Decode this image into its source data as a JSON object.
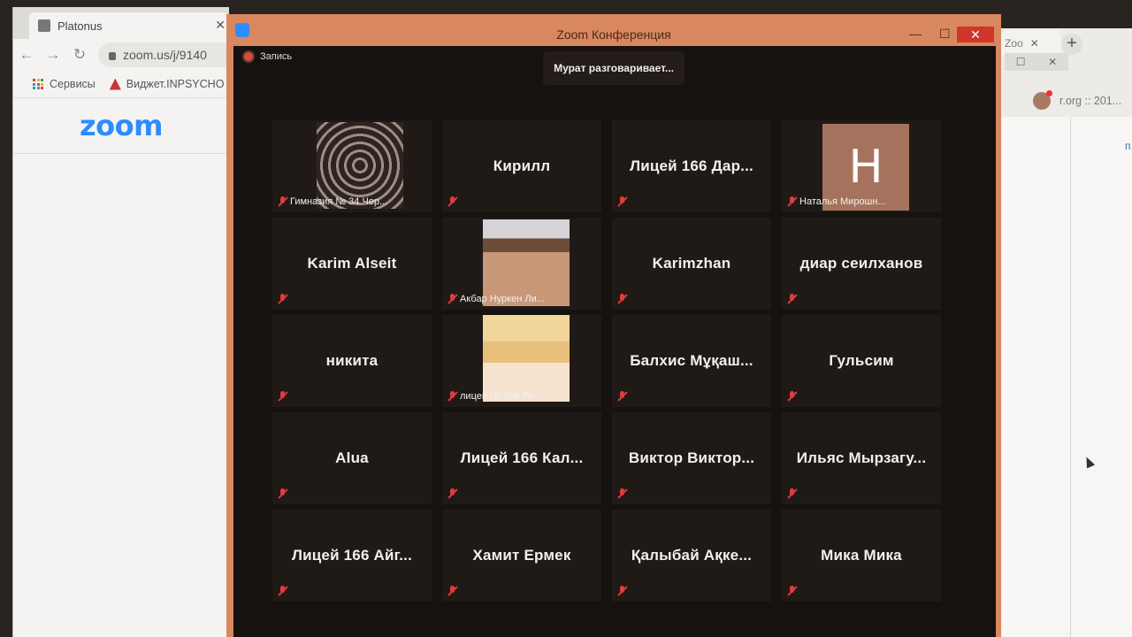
{
  "left_browser": {
    "tab_title": "Platonus",
    "url": "zoom.us/j/9140",
    "bookmarks": [
      "Сервисы",
      "Виджет.INPSYCHO"
    ],
    "logo_text": "zoom"
  },
  "right_browser": {
    "tab_title": "Zoo",
    "url_fragment": "r.org :: 201...",
    "link_fragment": "п"
  },
  "zoom_window": {
    "title": "Zoom Конференция",
    "recording_label": "Запись",
    "speaking_banner": "Мурат разговаривает...",
    "minimize_glyph": "—",
    "maximize_glyph": "☐",
    "close_glyph": "✕"
  },
  "participants": [
    {
      "name": "Гимназия № 34 Чер...",
      "video": "damask"
    },
    {
      "name": "Кирилл"
    },
    {
      "name": "Лицей 166 Дар..."
    },
    {
      "name": "Наталья Мирошн...",
      "video": "initial",
      "initial": "Н"
    },
    {
      "name": "Karim Alseit"
    },
    {
      "name": "Акбар Нуркен Ли...",
      "video": "photo"
    },
    {
      "name": "Karimzhan"
    },
    {
      "name": "диар сеилханов"
    },
    {
      "name": "никита"
    },
    {
      "name": "лицей № 166 Ре...",
      "video": "anime"
    },
    {
      "name": "Балхис Мұқаш..."
    },
    {
      "name": "Гульсим"
    },
    {
      "name": "Alua"
    },
    {
      "name": "Лицей 166 Кал..."
    },
    {
      "name": "Виктор Виктор..."
    },
    {
      "name": "Ильяс Мырзагу..."
    },
    {
      "name": "Лицей 166 Айг..."
    },
    {
      "name": "Хамит Ермек"
    },
    {
      "name": "Қалыбай Ақке..."
    },
    {
      "name": "Мика Мика"
    }
  ],
  "colors": {
    "zoom_border": "#d8875e",
    "zoom_blue": "#2d8cff",
    "mute_red": "#e33b3b",
    "close_red": "#d1362c"
  }
}
